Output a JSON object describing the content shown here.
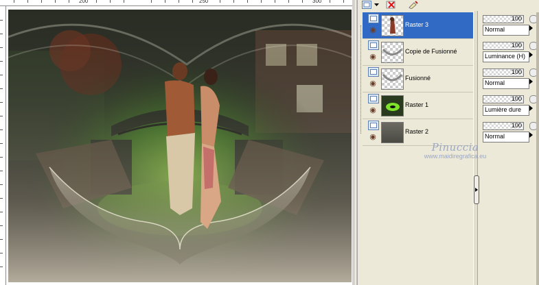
{
  "ruler": {
    "marks": [
      "200",
      "250",
      "300"
    ]
  },
  "layers": [
    {
      "name": "Raster 3",
      "opacity": "100",
      "blend_mode": "Normal",
      "selected": true,
      "thumb": "couple"
    },
    {
      "name": "Copie de Fusionné",
      "opacity": "100",
      "blend_mode": "Luminance (H)",
      "selected": false,
      "thumb": "arc-transparent"
    },
    {
      "name": "Fusionné",
      "opacity": "100",
      "blend_mode": "Normal",
      "selected": false,
      "thumb": "arc-transparent"
    },
    {
      "name": "Raster 1",
      "opacity": "100",
      "blend_mode": "Lumière dure",
      "selected": false,
      "thumb": "green-scene"
    },
    {
      "name": "Raster 2",
      "opacity": "100",
      "blend_mode": "Normal",
      "selected": false,
      "thumb": "dark-gradient"
    }
  ],
  "watermark": {
    "name": "Pinuccia",
    "url": "www.maidiregrafica.eu"
  },
  "icons": {
    "visibility": "eye-icon",
    "layer_type": "raster-layer-icon",
    "delete": "delete-layer-icon",
    "new": "new-layer-icon"
  },
  "colors": {
    "selection": "#316ac5",
    "panel": "#ece9d8",
    "watermark": "#9aa7c5"
  }
}
